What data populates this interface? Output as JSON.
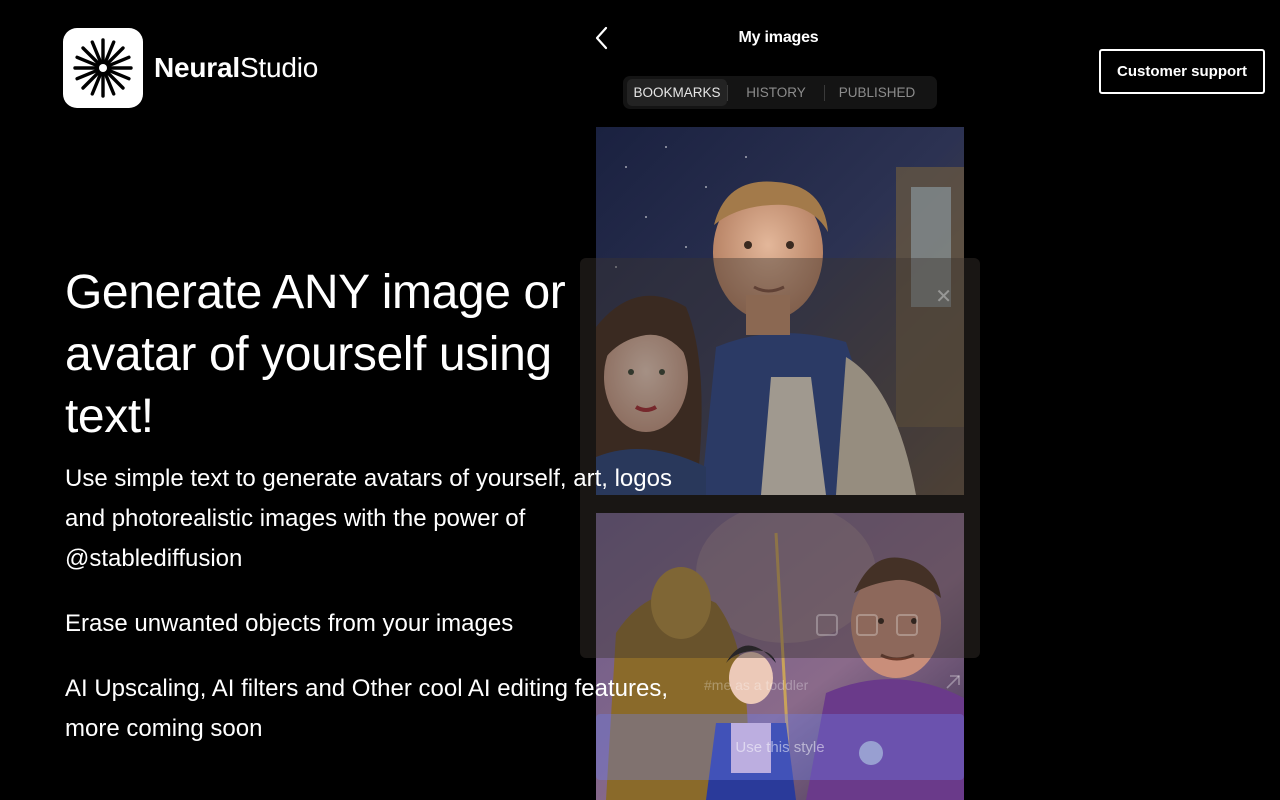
{
  "brand": {
    "name_bold": "Neural",
    "name_regular": "Studio",
    "logo_icon": "starburst-icon"
  },
  "header": {
    "support_label": "Customer support"
  },
  "phone": {
    "title": "My images",
    "tabs": [
      {
        "label": "BOOKMARKS",
        "active": true
      },
      {
        "label": "HISTORY",
        "active": false
      },
      {
        "label": "PUBLISHED",
        "active": false
      }
    ],
    "prompt_text": "#me as a toddler",
    "use_style_label": "Use this style",
    "icons": [
      "chevron-left-icon",
      "close-icon",
      "send-icon",
      "copy-icon",
      "share-icon",
      "expand-icon"
    ]
  },
  "hero": {
    "title": "Generate ANY image or avatar of yourself using text!",
    "description": "Use simple text to generate avatars of yourself, art, logos and photorealistic images with the power of @stablediffusion",
    "feature_1": "Erase unwanted objects from your images",
    "feature_2": "AI Upscaling, AI filters and Other cool AI editing features, more coming soon"
  },
  "colors": {
    "background": "#000000",
    "text": "#ffffff",
    "tab_active_bg": "#232323",
    "use_style_accent": "#6e82f0"
  }
}
